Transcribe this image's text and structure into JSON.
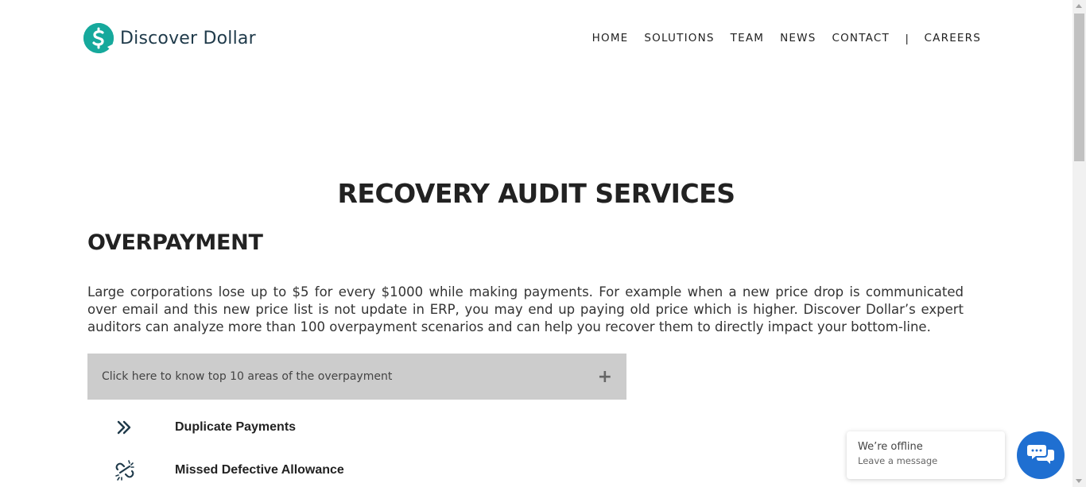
{
  "brand": {
    "name": "Discover Dollar",
    "accent_color": "#16a99c",
    "text_color": "#1f3a4a"
  },
  "nav": {
    "items": [
      {
        "label": "HOME"
      },
      {
        "label": "SOLUTIONS"
      },
      {
        "label": "TEAM"
      },
      {
        "label": "NEWS"
      },
      {
        "label": "CONTACT"
      }
    ],
    "separator": "|",
    "careers": "CAREERS"
  },
  "main": {
    "title": "RECOVERY AUDIT SERVICES",
    "section_title": "OVERPAYMENT",
    "paragraph": "Large corporations lose up to $5 for every $1000 while making payments. For example when a new price drop is communicated over email and this new price list is not update in ERP, you may end up paying old price which is higher. Discover Dollar’s expert auditors can analyze more than 100 overpayment scenarios and can help you recover them to directly impact your bottom-line.",
    "accordion": {
      "label": "Click here to know top 10 areas of the overpayment",
      "icon": "plus-icon"
    },
    "list": [
      {
        "label": "Duplicate Payments",
        "icon": "double-chevron-right-icon"
      },
      {
        "label": "Missed Defective Allowance",
        "icon": "broken-link-icon"
      }
    ]
  },
  "chat": {
    "status": "We’re offline",
    "cta": "Leave a message",
    "button_color": "#1f6fd1"
  }
}
